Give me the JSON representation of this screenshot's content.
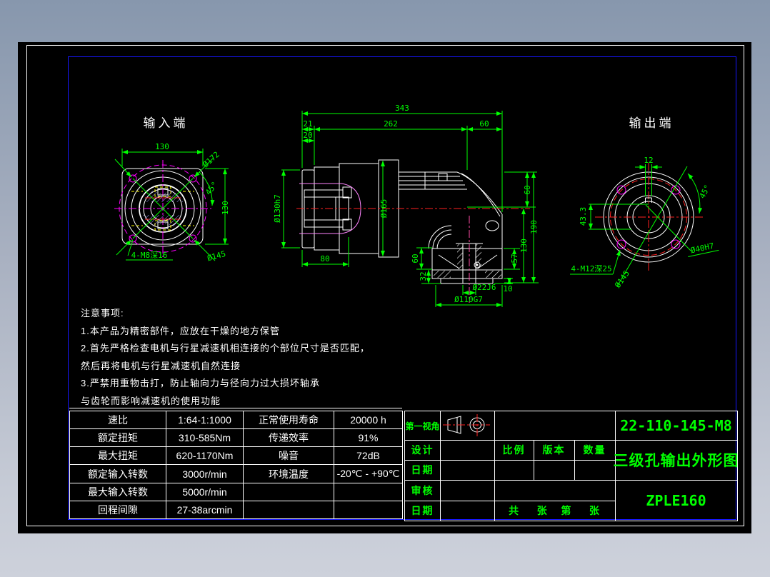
{
  "window": {
    "canvas_color": "#000000",
    "frame_white": "#ffffff",
    "frame_blue": "#1717ff",
    "background_top": "#8797ad",
    "background_bottom": "#cdd1db"
  },
  "colors": {
    "dimension_green": "#00ff00",
    "line_white": "#ffffff",
    "magenta": "#ff00ff",
    "pink": "#ff85ff",
    "red": "#ff2020",
    "yellow": "#ffff00",
    "hatch_lavender": "#8c8cff"
  },
  "views": {
    "input": {
      "title": "输入端",
      "dim_width_top": "130",
      "dim_height_right": "130",
      "dim_bolt_circle": "Ø172",
      "dim_angle": "45°",
      "dim_thread_holes": "4-M8深16",
      "dim_flange_dia": "Ø145"
    },
    "section": {
      "dim_total_length": "343",
      "dim_left_21": "21",
      "dim_mid_262": "262",
      "dim_right_60": "60",
      "dim_plate_20": "20",
      "dim_pilot_dia": "Ø130h7",
      "dim_flange_dia": "Ø165",
      "dim_depth_80": "80",
      "dim_top_to_axis_60": "60",
      "dim_overall_190": "190",
      "dim_axis_to_base_130": "130",
      "dim_flange_57": "57",
      "dim_flange_60": "60",
      "dim_base_32": "32",
      "dim_bore": "Ø22J6",
      "dim_spigot": "Ø110G7",
      "dim_lip_10": "10"
    },
    "output": {
      "title": "输出端",
      "dim_keyway_12": "12",
      "dim_angle": "45°",
      "dim_keyway_433": "43.3",
      "dim_bore": "Ø40H7",
      "dim_thread_holes": "4-M12深25",
      "dim_bolt_circle": "Ø145"
    }
  },
  "notes": {
    "title": "注意事项:",
    "line1": "1.本产品为精密部件，应放在干燥的地方保管",
    "line2": "2.首先严格检查电机与行星减速机相连接的个部位尺寸是否匹配，",
    "line3": "然后再将电机与行星减速机自然连接",
    "line4": "3.严禁用重物击打，防止轴向力与径向力过大损坏轴承",
    "line5": "与齿轮而影响减速机的使用功能"
  },
  "spec_table": {
    "rows": [
      [
        "速比",
        "1:64-1:1000",
        "正常使用寿命",
        "20000 h"
      ],
      [
        "额定扭矩",
        "310-585Nm",
        "传递效率",
        "91%"
      ],
      [
        "最大扭矩",
        "620-1170Nm",
        "噪音",
        "72dB"
      ],
      [
        "额定输入转数",
        "3000r/min",
        "环境温度",
        "-20℃ - +90℃"
      ],
      [
        "最大输入转数",
        "5000r/min",
        "",
        ""
      ],
      [
        "回程间隙",
        "27-38arcmin",
        "",
        ""
      ]
    ]
  },
  "title_block": {
    "first_angle": "第一视角",
    "design": "设计",
    "date1": "日期",
    "check": "审核",
    "date2": "日期",
    "scale": "比例",
    "version": "版本",
    "quantity": "数量",
    "sheets": "共    张   第    张",
    "part_no": "22-110-145-M8",
    "drawing_title": "三级孔输出外形图",
    "model": "ZPLE160"
  }
}
